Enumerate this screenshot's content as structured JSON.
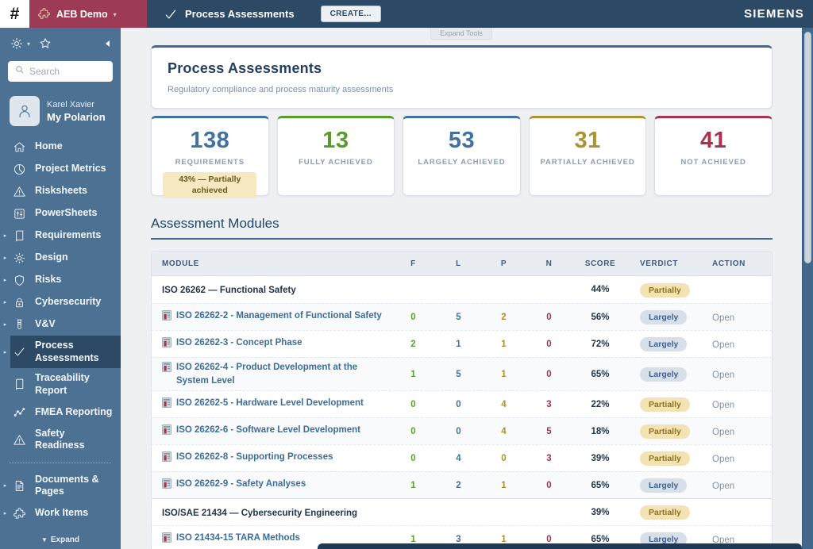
{
  "topbar": {
    "logo": "#",
    "project": "AEB Demo",
    "page": "Process Assessments",
    "create_label": "CREATE...",
    "brand": "SIEMENS"
  },
  "tools_tab": "Expand Tools",
  "sidebar": {
    "search_placeholder": "Search",
    "user": {
      "name": "Karel Xavier",
      "space": "My Polarion"
    },
    "items": [
      {
        "label": "Home",
        "icon": "home"
      },
      {
        "label": "Project Metrics",
        "icon": "metrics"
      },
      {
        "label": "Risksheets",
        "icon": "warning"
      },
      {
        "label": "PowerSheets",
        "icon": "sliders"
      },
      {
        "label": "Requirements",
        "icon": "book",
        "expandable": true
      },
      {
        "label": "Design",
        "icon": "gear",
        "expandable": true
      },
      {
        "label": "Risks",
        "icon": "shield",
        "expandable": true
      },
      {
        "label": "Cybersecurity",
        "icon": "lock",
        "expandable": true
      },
      {
        "label": "V&V",
        "icon": "testtube",
        "expandable": true
      },
      {
        "label": "Process Assessments",
        "icon": "check",
        "expandable": true,
        "selected": true
      },
      {
        "label": "Traceability Report",
        "icon": "book"
      },
      {
        "label": "FMEA Reporting",
        "icon": "fmea"
      },
      {
        "label": "Safety Readiness",
        "icon": "warning"
      },
      {
        "divider": true
      },
      {
        "label": "Documents & Pages",
        "icon": "document",
        "expandable": true
      },
      {
        "label": "Work Items",
        "icon": "puzzle",
        "expandable": true
      }
    ],
    "expand_label": "Expand"
  },
  "header": {
    "title": "Process Assessments",
    "subtitle": "Regulatory compliance and process maturity assessments"
  },
  "stats": [
    {
      "value": "138",
      "label": "REQUIREMENTS",
      "accent": "#41719e",
      "badge": "43% — Partially achieved"
    },
    {
      "value": "13",
      "label": "FULLY ACHIEVED",
      "accent": "#5a9b2e"
    },
    {
      "value": "53",
      "label": "LARGELY ACHIEVED",
      "accent": "#41719e"
    },
    {
      "value": "31",
      "label": "PARTIALLY ACHIEVED",
      "accent": "#ad9132"
    },
    {
      "value": "41",
      "label": "NOT ACHIEVED",
      "accent": "#a73351"
    }
  ],
  "modules": {
    "title": "Assessment Modules",
    "columns": [
      "MODULE",
      "F",
      "L",
      "P",
      "N",
      "SCORE",
      "VERDICT",
      "ACTION"
    ],
    "rows": [
      {
        "type": "group",
        "module": "ISO 26262 — Functional Safety",
        "score": "44%",
        "verdict": "Partially"
      },
      {
        "type": "item",
        "module": "ISO 26262-2 - Management of Functional Safety",
        "f": "0",
        "l": "5",
        "p": "2",
        "n": "0",
        "score": "56%",
        "verdict": "Largely",
        "action": "Open"
      },
      {
        "type": "item",
        "module": "ISO 26262-3 - Concept Phase",
        "f": "2",
        "l": "1",
        "p": "1",
        "n": "0",
        "score": "72%",
        "verdict": "Largely",
        "action": "Open"
      },
      {
        "type": "item",
        "module": "ISO 26262-4 - Product Development at the System Level",
        "f": "1",
        "l": "5",
        "p": "1",
        "n": "0",
        "score": "65%",
        "verdict": "Largely",
        "action": "Open"
      },
      {
        "type": "item",
        "module": "ISO 26262-5 - Hardware Level Development",
        "f": "0",
        "l": "0",
        "p": "4",
        "n": "3",
        "score": "22%",
        "verdict": "Partially",
        "action": "Open"
      },
      {
        "type": "item",
        "module": "ISO 26262-6 - Software Level Development",
        "f": "0",
        "l": "0",
        "p": "4",
        "n": "5",
        "score": "18%",
        "verdict": "Partially",
        "action": "Open"
      },
      {
        "type": "item",
        "module": "ISO 26262-8 - Supporting Processes",
        "f": "0",
        "l": "4",
        "p": "0",
        "n": "3",
        "score": "39%",
        "verdict": "Partially",
        "action": "Open"
      },
      {
        "type": "item",
        "module": "ISO 26262-9 - Safety Analyses",
        "f": "1",
        "l": "2",
        "p": "1",
        "n": "0",
        "score": "65%",
        "verdict": "Largely",
        "action": "Open"
      },
      {
        "type": "group",
        "module": "ISO/SAE 21434 — Cybersecurity Engineering",
        "score": "39%",
        "verdict": "Partially"
      },
      {
        "type": "item",
        "module": "ISO 21434-15 TARA Methods",
        "f": "1",
        "l": "3",
        "p": "1",
        "n": "0",
        "score": "65%",
        "verdict": "Largely",
        "action": "Open"
      }
    ]
  },
  "colors": {
    "topbar": "#2c4a66",
    "project_section": "#9d3a55",
    "sidebar": "#4c7193",
    "sidebar_selected": "#2c4a66",
    "card_accent": "#44698e",
    "verdict_largely_bg": "#d7dfe9",
    "verdict_largely_text": "#44618a",
    "verdict_partially_bg": "#f3e3b4",
    "verdict_partially_text": "#8d7322",
    "stat_badge_bg": "#f6e8c0"
  }
}
